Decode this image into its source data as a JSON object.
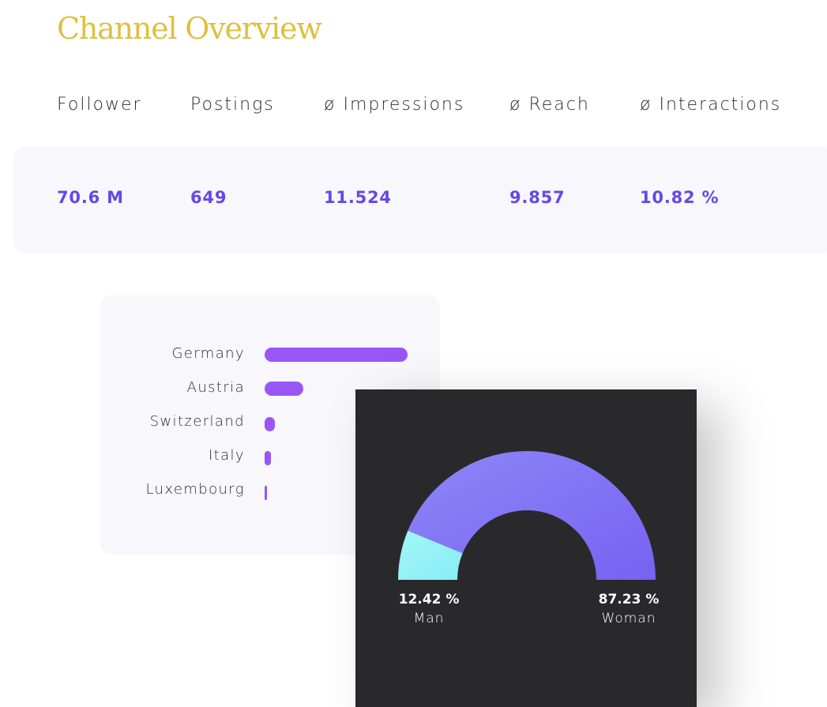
{
  "page": {
    "title": "Channel Overview"
  },
  "metrics": [
    {
      "label": "Follower",
      "value": "70.6 M"
    },
    {
      "label": "Postings",
      "value": "649"
    },
    {
      "label": "ø Impressions",
      "value": "11.524"
    },
    {
      "label": "ø Reach",
      "value": "9.857"
    },
    {
      "label": "ø Interactions",
      "value": "10.82 %"
    }
  ],
  "countries": {
    "bar_color": "#9a55f5",
    "items": [
      {
        "label": "Germany",
        "share": 1.0
      },
      {
        "label": "Austria",
        "share": 0.27
      },
      {
        "label": "Switzerland",
        "share": 0.07
      },
      {
        "label": "Italy",
        "share": 0.045
      },
      {
        "label": "Luxembourg",
        "share": 0.012
      }
    ]
  },
  "gender": {
    "man": {
      "percent": "12.42 %",
      "label": "Man",
      "value": 12.42,
      "color": "#9af2f5"
    },
    "woman": {
      "percent": "87.23 %",
      "label": "Woman",
      "value": 87.23,
      "color": "#7f6df5"
    }
  }
}
